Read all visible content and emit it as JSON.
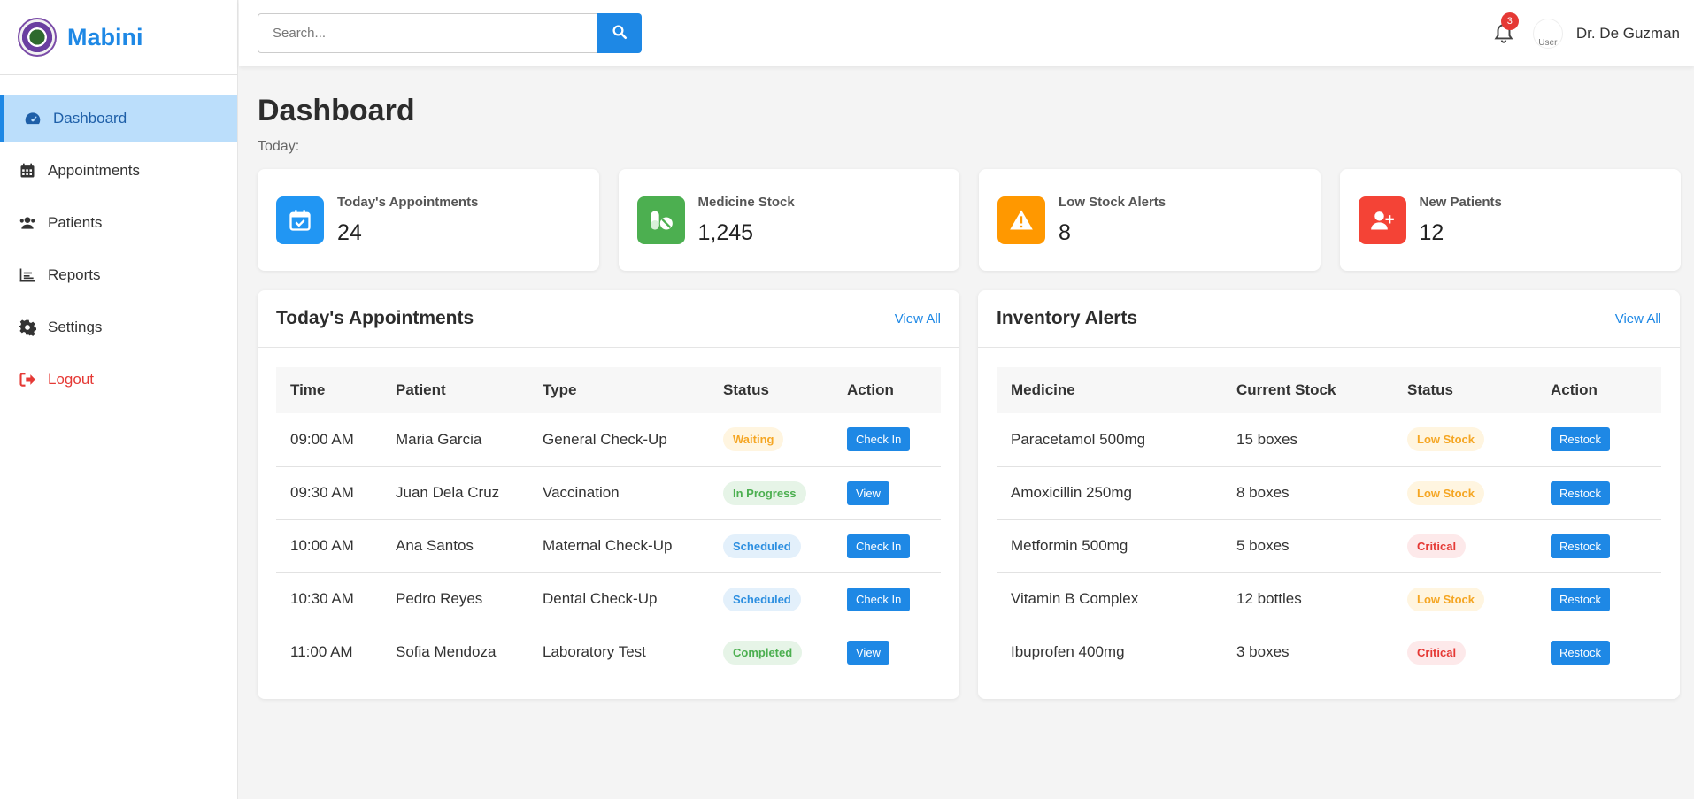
{
  "brand": {
    "name": "Mabini"
  },
  "sidebar": {
    "items": [
      {
        "label": "Dashboard",
        "icon": "gauge-icon",
        "active": true
      },
      {
        "label": "Appointments",
        "icon": "calendar-icon"
      },
      {
        "label": "Patients",
        "icon": "users-icon"
      },
      {
        "label": "Reports",
        "icon": "chart-icon"
      },
      {
        "label": "Settings",
        "icon": "gear-icon"
      },
      {
        "label": "Logout",
        "icon": "logout-icon"
      }
    ]
  },
  "topbar": {
    "search_placeholder": "Search...",
    "notifications_count": "3",
    "avatar_alt": "User",
    "user_name": "Dr. De Guzman"
  },
  "page": {
    "title": "Dashboard",
    "today_label": "Today:"
  },
  "stats": [
    {
      "label": "Today's Appointments",
      "value": "24",
      "icon": "calendar-check-icon",
      "color": "#2196f3"
    },
    {
      "label": "Medicine Stock",
      "value": "1,245",
      "icon": "pills-icon",
      "color": "#4caf50"
    },
    {
      "label": "Low Stock Alerts",
      "value": "8",
      "icon": "warning-icon",
      "color": "#ff9800"
    },
    {
      "label": "New Patients",
      "value": "12",
      "icon": "user-plus-icon",
      "color": "#f44336"
    }
  ],
  "appointments": {
    "title": "Today's Appointments",
    "view_all": "View All",
    "columns": [
      "Time",
      "Patient",
      "Type",
      "Status",
      "Action"
    ],
    "rows": [
      {
        "time": "09:00 AM",
        "patient": "Maria Garcia",
        "type": "General Check-Up",
        "status": "Waiting",
        "action": "Check In"
      },
      {
        "time": "09:30 AM",
        "patient": "Juan Dela Cruz",
        "type": "Vaccination",
        "status": "In Progress",
        "action": "View"
      },
      {
        "time": "10:00 AM",
        "patient": "Ana Santos",
        "type": "Maternal Check-Up",
        "status": "Scheduled",
        "action": "Check In"
      },
      {
        "time": "10:30 AM",
        "patient": "Pedro Reyes",
        "type": "Dental Check-Up",
        "status": "Scheduled",
        "action": "Check In"
      },
      {
        "time": "11:00 AM",
        "patient": "Sofia Mendoza",
        "type": "Laboratory Test",
        "status": "Completed",
        "action": "View"
      }
    ]
  },
  "inventory": {
    "title": "Inventory Alerts",
    "view_all": "View All",
    "columns": [
      "Medicine",
      "Current Stock",
      "Status",
      "Action"
    ],
    "rows": [
      {
        "medicine": "Paracetamol 500mg",
        "stock": "15 boxes",
        "status": "Low Stock",
        "action": "Restock"
      },
      {
        "medicine": "Amoxicillin 250mg",
        "stock": "8 boxes",
        "status": "Low Stock",
        "action": "Restock"
      },
      {
        "medicine": "Metformin 500mg",
        "stock": "5 boxes",
        "status": "Critical",
        "action": "Restock"
      },
      {
        "medicine": "Vitamin B Complex",
        "stock": "12 bottles",
        "status": "Low Stock",
        "action": "Restock"
      },
      {
        "medicine": "Ibuprofen 400mg",
        "stock": "3 boxes",
        "status": "Critical",
        "action": "Restock"
      }
    ]
  }
}
